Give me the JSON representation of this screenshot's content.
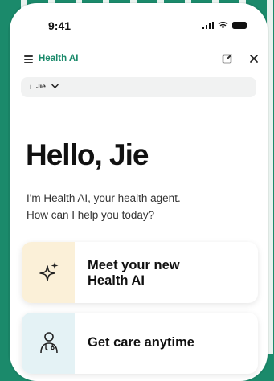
{
  "status_bar": {
    "time": "9:41"
  },
  "app_bar": {
    "title": "Health AI",
    "menu_icon": "menu-icon",
    "edit_icon": "edit-icon",
    "close_icon": "close-icon",
    "close_glyph": "✕"
  },
  "profile": {
    "info_glyph": "i",
    "name": "Jie",
    "chevron_icon": "chevron-down-icon"
  },
  "greeting": "Hello, Jie",
  "intro": {
    "line1": "I'm Health AI, your health agent.",
    "line2": "How can I help you today?"
  },
  "cards": [
    {
      "icon": "sparkle-icon",
      "title_line1": "Meet your new",
      "title_line2": "Health AI",
      "icon_bg": "#fbf0d8"
    },
    {
      "icon": "doctor-icon",
      "title_line1": "Get care anytime",
      "icon_bg": "#e4f2f5"
    }
  ],
  "colors": {
    "brand": "#1b8a6b",
    "text": "#111111"
  }
}
